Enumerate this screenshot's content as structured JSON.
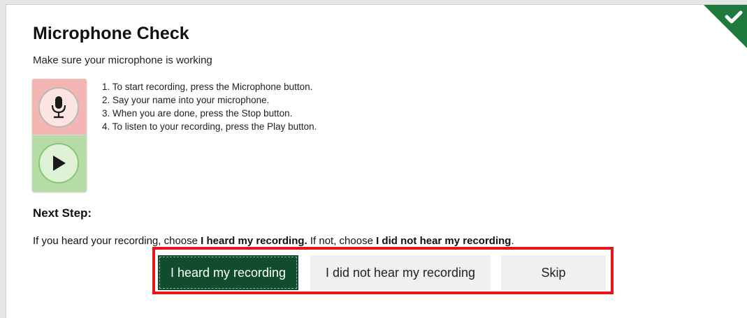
{
  "header": {
    "title": "Microphone Check",
    "subtitle": "Make sure your microphone is working"
  },
  "recorder": {
    "mic_icon": "microphone-icon",
    "play_icon": "play-icon",
    "colors": {
      "mic_panel": "#f4b6b2",
      "play_panel": "#b5dca5"
    }
  },
  "steps": [
    "1. To start recording, press the Microphone button.",
    "2. Say your name into your microphone.",
    "3. When you are done, press the Stop button.",
    "4. To listen to your recording, press the Play button."
  ],
  "next_step": {
    "heading": "Next Step:",
    "text_1": "If you heard your recording, choose ",
    "bold_1": "I heard my recording.",
    "text_2": " If not, choose ",
    "bold_2": "I did not hear my recording",
    "text_3": "."
  },
  "buttons": {
    "heard": "I heard my recording",
    "not_heard": "I did not hear my recording",
    "skip": "Skip"
  },
  "status": {
    "corner_icon": "checkmark-icon",
    "accent": "#1e7a3c"
  },
  "colors": {
    "selected_button": "#0f4d2c",
    "highlight_border": "#e8141b"
  }
}
